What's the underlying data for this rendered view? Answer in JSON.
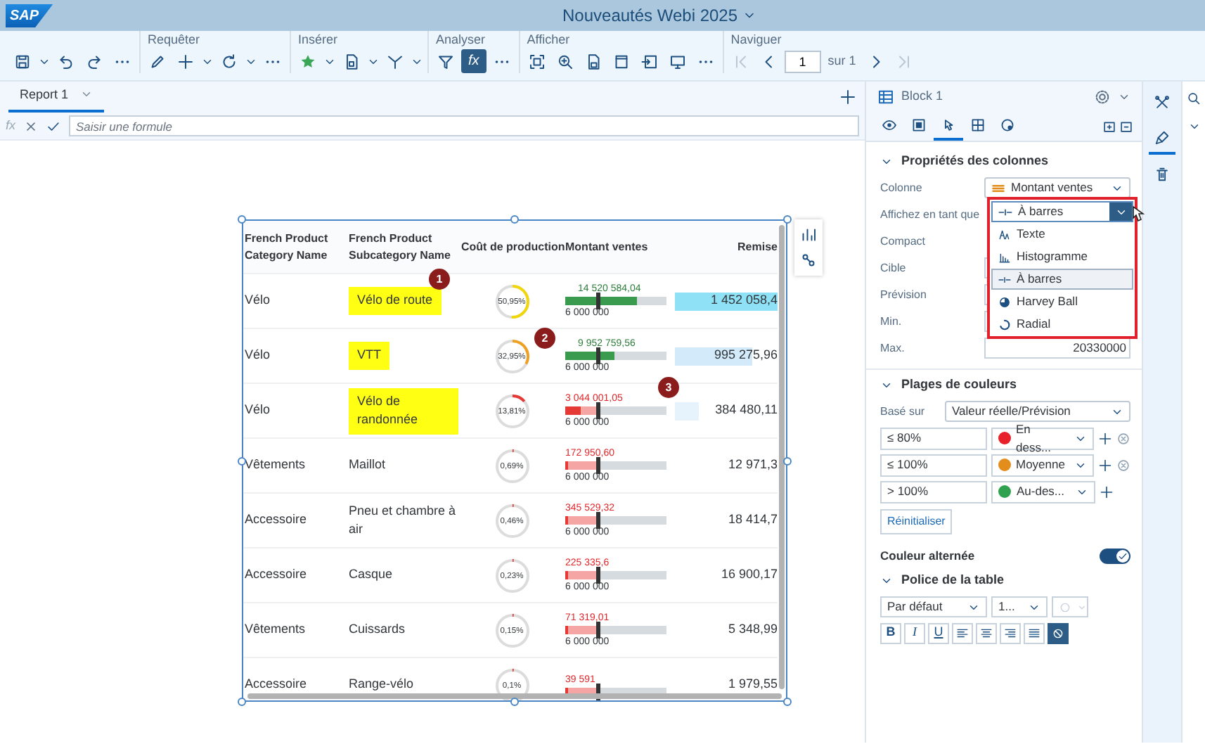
{
  "app": {
    "logo": "SAP",
    "title": "Nouveautés Webi 2025"
  },
  "toolbar": {
    "groups": [
      {
        "tools": [
          {
            "kind": "save"
          },
          {
            "kind": "caret"
          },
          {
            "kind": "undo"
          },
          {
            "kind": "redo"
          },
          {
            "kind": "more"
          }
        ]
      },
      {
        "label": "Requêter",
        "tools": [
          {
            "kind": "pencil"
          },
          {
            "kind": "add"
          },
          {
            "kind": "caret"
          },
          {
            "kind": "refresh"
          },
          {
            "kind": "caret"
          },
          {
            "kind": "more"
          }
        ]
      },
      {
        "label": "Insérer",
        "tools": [
          {
            "kind": "star"
          },
          {
            "kind": "caret"
          },
          {
            "kind": "doc"
          },
          {
            "kind": "caret"
          },
          {
            "kind": "branch"
          },
          {
            "kind": "caret"
          }
        ]
      },
      {
        "label": "Analyser",
        "tools": [
          {
            "kind": "filter"
          },
          {
            "kind": "formula",
            "text": "fx",
            "on": true
          },
          {
            "kind": "more"
          }
        ]
      },
      {
        "label": "Afficher",
        "tools": [
          {
            "kind": "fit"
          },
          {
            "kind": "zoom"
          },
          {
            "kind": "page"
          },
          {
            "kind": "header"
          },
          {
            "kind": "import"
          },
          {
            "kind": "monitor"
          },
          {
            "kind": "more"
          }
        ]
      },
      {
        "label": "Naviguer",
        "tools": [
          {
            "kind": "first",
            "disabled": true
          },
          {
            "kind": "prev",
            "disabled": false
          },
          {
            "kind": "pageinput",
            "value": "1",
            "disabled": false
          },
          {
            "kind": "text",
            "text": "sur 1",
            "disabled": false
          },
          {
            "kind": "next",
            "disabled": false
          },
          {
            "kind": "last",
            "disabled": true
          }
        ]
      }
    ]
  },
  "report_tabs": [
    {
      "label": "Report 1",
      "selected": true
    }
  ],
  "formula_bar": {
    "function_label": "fx",
    "placeholder": "Saisir une formule"
  },
  "table": {
    "columns": [
      "French Product Category Name",
      "French Product Subcategory Name",
      "Coût de production",
      "Montant ventes",
      "Remise"
    ],
    "rows": [
      {
        "category": "Vélo",
        "subcategory": "Vélo de route",
        "highlighted": true,
        "cost": {
          "text": "50,95%",
          "color": "#f2d60c"
        },
        "sales": {
          "text": "14 520 584,04",
          "kind": "above",
          "level": 0.714,
          "target": "6 000 000"
        },
        "discount": {
          "text": "1 452 058,4",
          "level": 1,
          "color": "#8fe1f6"
        }
      },
      {
        "category": "Vélo",
        "subcategory": "VTT",
        "highlighted": true,
        "cost": {
          "text": "32,95%",
          "color": "#f0a020"
        },
        "sales": {
          "text": "9 952 759,56",
          "kind": "above",
          "level": 0.49,
          "target": "6 000 000"
        },
        "discount": {
          "text": "995 275,96",
          "level": 0.75,
          "color": "#d2eafa"
        }
      },
      {
        "category": "Vélo",
        "subcategory": "Vélo de randonnée",
        "highlighted": true,
        "cost": {
          "text": "13,81%",
          "color": "#e53935"
        },
        "sales": {
          "text": "3 044 001,05",
          "kind": "below",
          "level": 0.15,
          "target": "6 000 000"
        },
        "discount": {
          "text": "384 480,11",
          "level": 0.23,
          "color": "#e6f3fc"
        }
      },
      {
        "category": "Vêtements",
        "subcategory": "Maillot",
        "highlighted": false,
        "cost": {
          "text": "0,69%",
          "color": "#e53935"
        },
        "sales": {
          "text": "172 950,60",
          "kind": "below",
          "level": 0.0085,
          "target": "6 000 000"
        },
        "discount": {
          "text": "12 971,3"
        }
      },
      {
        "category": "Accessoire",
        "subcategory": "Pneu et chambre à air",
        "highlighted": false,
        "cost": {
          "text": "0,46%",
          "color": "#e53935"
        },
        "sales": {
          "text": "345 529,32",
          "kind": "below",
          "level": 0.017,
          "target": "6 000 000"
        },
        "discount": {
          "text": "18 414,7"
        }
      },
      {
        "category": "Accessoire",
        "subcategory": "Casque",
        "highlighted": false,
        "cost": {
          "text": "0,23%",
          "color": "#e53935"
        },
        "sales": {
          "text": "225 335,6",
          "kind": "below",
          "level": 0.011,
          "target": "6 000 000"
        },
        "discount": {
          "text": "16 900,17"
        }
      },
      {
        "category": "Vêtements",
        "subcategory": "Cuissards",
        "highlighted": false,
        "cost": {
          "text": "0,15%",
          "color": "#e53935"
        },
        "sales": {
          "text": "71 319,01",
          "kind": "below",
          "level": 0.0035,
          "target": "6 000 000"
        },
        "discount": {
          "text": "5 348,99"
        }
      },
      {
        "category": "Accessoire",
        "subcategory": "Range-vélo",
        "highlighted": false,
        "cost": {
          "text": "0,1%",
          "color": "#e53935"
        },
        "sales": {
          "text": "39 591",
          "kind": "below",
          "level": 0.0019
        },
        "discount": {
          "text": "1 979,55"
        }
      }
    ]
  },
  "callouts": [
    "1",
    "2",
    "3"
  ],
  "panel": {
    "title": "Block 1",
    "tabs": [
      {
        "kind": "eye",
        "selected": false
      },
      {
        "kind": "image",
        "selected": false
      },
      {
        "kind": "pointer",
        "selected": true
      },
      {
        "kind": "layout",
        "selected": false
      },
      {
        "kind": "palette",
        "selected": false
      }
    ],
    "columns_section": {
      "title": "Propriétés des colonnes",
      "expanded": true,
      "fields": [
        {
          "label": "Colonne",
          "kind": "select",
          "value": "Montant ventes"
        },
        {
          "label": "Affichez en tant que",
          "kind": "open-select",
          "value": "À barres"
        },
        {
          "label": "Compact",
          "kind": "plain"
        },
        {
          "label": "Cible",
          "kind": "input"
        },
        {
          "label": "Prévision",
          "kind": "input"
        },
        {
          "label": "Min.",
          "kind": "input"
        },
        {
          "label": "Max.",
          "kind": "input",
          "value": "20330000"
        }
      ],
      "options": [
        {
          "kind": "text",
          "label": "Texte",
          "selected": false
        },
        {
          "kind": "histogram",
          "label": "Histogramme",
          "selected": false
        },
        {
          "kind": "bar",
          "label": "À barres",
          "selected": true
        },
        {
          "kind": "harvey",
          "label": "Harvey Ball",
          "selected": false
        },
        {
          "kind": "radial",
          "label": "Radial",
          "selected": false
        }
      ]
    },
    "ranges_section": {
      "title": "Plages de couleurs",
      "expanded": true,
      "based_on_label": "Basé sur",
      "based_on": "Valeur réelle/Prévision",
      "ranges": [
        {
          "threshold": "≤ 80%",
          "color": "#e8202a",
          "label": "En dess...",
          "removable": true
        },
        {
          "threshold": "≤ 100%",
          "color": "#e38d1c",
          "label": "Moyenne",
          "removable": true
        },
        {
          "threshold": "> 100%",
          "color": "#30a14e",
          "label": "Au-des...",
          "removable": false
        }
      ],
      "reset": "Réinitialiser"
    },
    "alternate": {
      "label": "Couleur alternée",
      "on": true
    },
    "font_section": {
      "title": "Police de la table",
      "expanded": true,
      "font": "Par défaut",
      "size": "1...",
      "format": [
        {
          "kind": "bold",
          "text": "B",
          "selected": false
        },
        {
          "kind": "italic",
          "text": "I",
          "selected": false
        },
        {
          "kind": "underline",
          "text": "U",
          "selected": false
        },
        {
          "kind": "left",
          "selected": false
        },
        {
          "kind": "center",
          "selected": false
        },
        {
          "kind": "right",
          "selected": false
        },
        {
          "kind": "justify",
          "selected": false
        },
        {
          "kind": "wrap",
          "selected": true
        }
      ]
    }
  },
  "side_strip": [
    {
      "kind": "tools",
      "selected": false
    },
    {
      "kind": "brush",
      "selected": true
    },
    {
      "kind": "trash",
      "selected": false
    }
  ]
}
